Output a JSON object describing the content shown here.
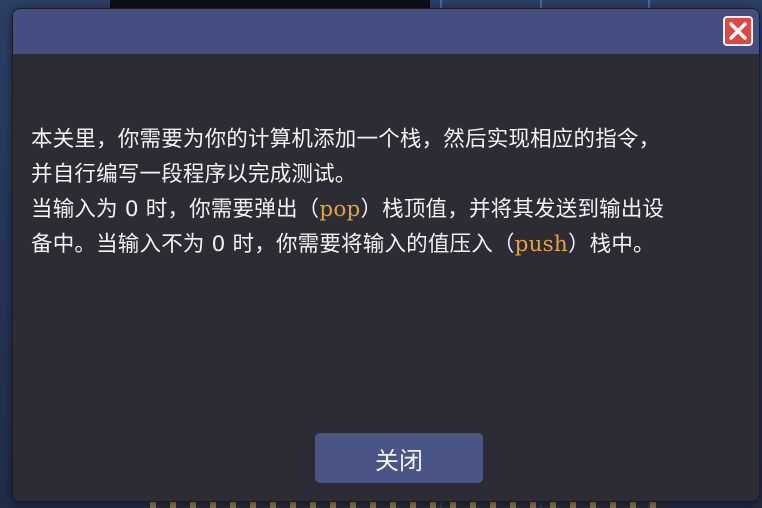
{
  "dialog": {
    "message": {
      "line1": "本关里，你需要为你的计算机添加一个栈，然后实现相应的指令，",
      "line2": "并自行编写一段程序以完成测试。",
      "line3_pre": "当输入为 0 时，你需要弹出（",
      "line3_kw": "pop",
      "line3_post": "）栈顶值，并将其发送到输出设",
      "line4_pre": "备中。当输入不为 0 时，你需要将输入的值压入（",
      "line4_kw": "push",
      "line4_post": "）栈中。"
    },
    "close_button_label": "关闭",
    "close_icon": "close-x-icon"
  },
  "colors": {
    "dialog_bg": "#2c2c35",
    "titlebar": "#454e80",
    "keyword": "#e8a23a",
    "close_icon_bg": "#e0483e",
    "button_bg": "#4a5585"
  }
}
